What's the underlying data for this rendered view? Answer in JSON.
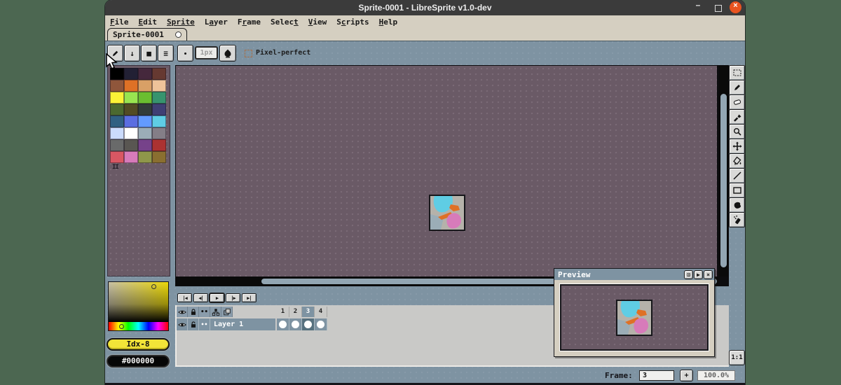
{
  "titlebar": {
    "title": "Sprite-0001 - LibreSprite v1.0-dev",
    "minimize_glyph": "–",
    "close_glyph": "×"
  },
  "menu": {
    "items": [
      {
        "pre": "",
        "key": "F",
        "post": "ile"
      },
      {
        "pre": "",
        "key": "E",
        "post": "dit"
      },
      {
        "pre": "",
        "key": "Sprite",
        "post": ""
      },
      {
        "pre": "L",
        "key": "a",
        "post": "yer"
      },
      {
        "pre": "F",
        "key": "r",
        "post": "ame"
      },
      {
        "pre": "Selec",
        "key": "t",
        "post": ""
      },
      {
        "pre": "",
        "key": "V",
        "post": "iew"
      },
      {
        "pre": "S",
        "key": "c",
        "post": "ripts"
      },
      {
        "pre": "",
        "key": "H",
        "post": "elp"
      }
    ]
  },
  "tab": {
    "label": "Sprite-0001"
  },
  "context_bar": {
    "sort_glyph": "↓",
    "preset_glyph": "■",
    "options_glyph": "≡",
    "brush_size": "1px",
    "pixel_perfect_label": "Pixel-perfect"
  },
  "palette": {
    "colors": [
      "#000000",
      "#222034",
      "#45283c",
      "#663931",
      "#8f563b",
      "#df7126",
      "#d9a066",
      "#eec39a",
      "#fbf236",
      "#99e550",
      "#6abe30",
      "#37946e",
      "#4b692f",
      "#524b24",
      "#323c39",
      "#3f3f74",
      "#306082",
      "#5b6ee1",
      "#639bff",
      "#5fcde4",
      "#cbdbfc",
      "#ffffff",
      "#9badb7",
      "#847e87",
      "#696a6a",
      "#595652",
      "#76428a",
      "#ac3232",
      "#d95763",
      "#d77bba",
      "#8f974a",
      "#8a6f30"
    ],
    "resize_handle": "II",
    "index_button": "Idx-8",
    "hex_button": "#000000"
  },
  "sprite": {
    "colors": {
      "bg": "#b5b2aa",
      "shadow": "#9badb7",
      "sky": "#5fcde4",
      "orange1": "#df7126",
      "orange2": "#df7126",
      "blob": "#d77bba"
    }
  },
  "tools": [
    "rectangular-marquee",
    "pencil",
    "eraser",
    "eyedropper",
    "zoom",
    "move",
    "paint-bucket",
    "line",
    "rectangle",
    "blur",
    "spray"
  ],
  "playback": {
    "first": "|◀",
    "prev": "◀|",
    "play": "▶",
    "next": "|▶",
    "last": "▶|"
  },
  "timeline": {
    "header_icons": [
      "eye",
      "lock",
      "continuous",
      "onion-skin",
      "duplicate"
    ],
    "frames": [
      "1",
      "2",
      "3",
      "4"
    ],
    "active_frame": "3",
    "dots_label": "••",
    "layer": {
      "name": "Layer 1"
    }
  },
  "preview": {
    "title": "Preview",
    "center_glyph": "⊡",
    "play_glyph": "▶",
    "close_glyph": "×"
  },
  "status": {
    "frame_label": "Frame:",
    "frame_value": "3",
    "add_frame_glyph": "+",
    "zoom_value": "100.0%",
    "one_to_one": "1:1"
  }
}
